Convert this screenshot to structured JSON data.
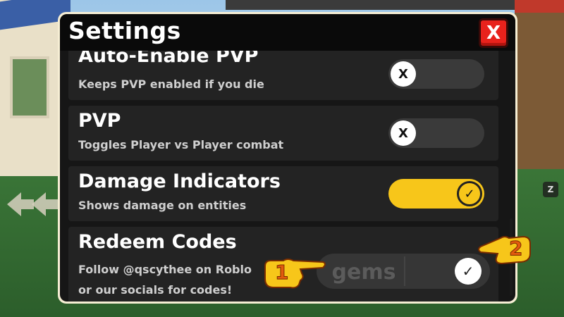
{
  "window": {
    "title": "Settings",
    "close_label": "X"
  },
  "settings": [
    {
      "title": "Auto-Enable PVP",
      "description": "Keeps PVP enabled if you die",
      "toggle": "off",
      "knob_symbol": "X"
    },
    {
      "title": "PVP",
      "description": "Toggles Player vs Player combat",
      "toggle": "off",
      "knob_symbol": "X"
    },
    {
      "title": "Damage Indicators",
      "description": "Shows damage on entities",
      "toggle": "on",
      "knob_symbol": "✓"
    }
  ],
  "redeem": {
    "title": "Redeem Codes",
    "description_line1": "Follow @qscythee on Roblo",
    "description_line2": "or our socials for codes!",
    "input_value": "gems",
    "submit_symbol": "✓"
  },
  "markers": [
    {
      "label": "1"
    },
    {
      "label": "2"
    }
  ],
  "hud": {
    "key_hint": "Z"
  },
  "colors": {
    "accent_yellow": "#f7c61a",
    "close_red": "#e8221c",
    "marker_orange": "#e25a0e"
  }
}
